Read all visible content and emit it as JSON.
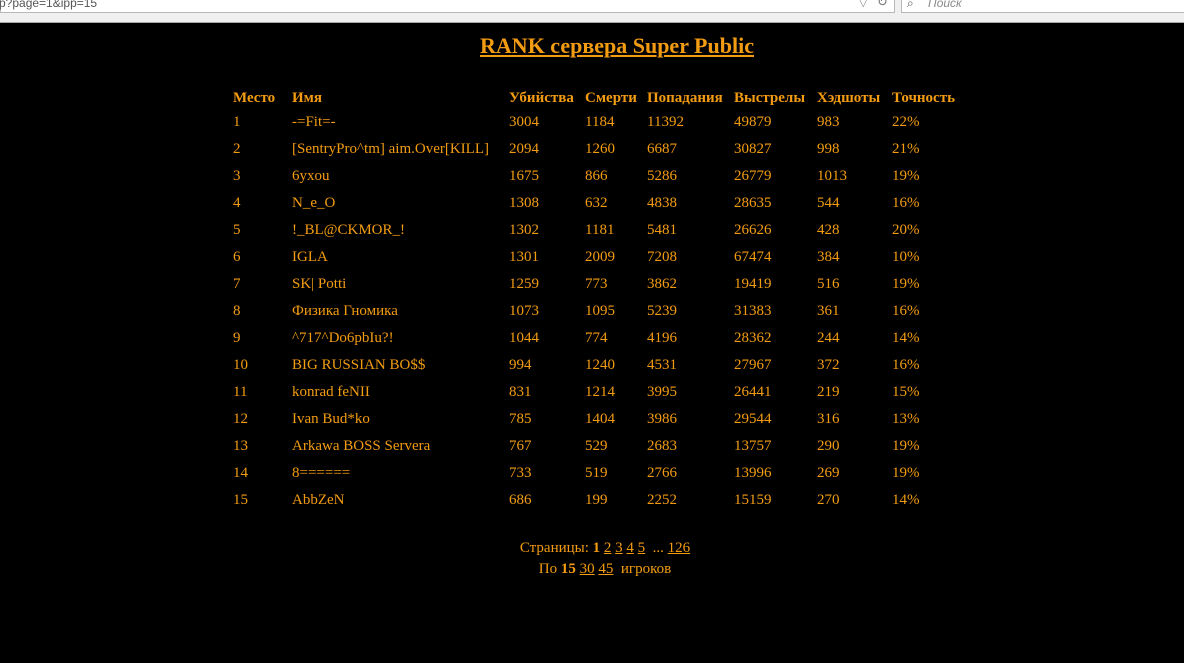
{
  "browser": {
    "url": "p?page=1&ipp=15",
    "search_placeholder": "Поиск"
  },
  "title": "RANK сервера Super Public",
  "table": {
    "headers": [
      "Место",
      "Имя",
      "Убийства",
      "Смерти",
      "Попадания",
      "Выстрелы",
      "Хэдшоты",
      "Точность"
    ],
    "rows": [
      [
        "1",
        "-=Fit=-",
        "3004",
        "1184",
        "11392",
        "49879",
        "983",
        "22%"
      ],
      [
        "2",
        "[SentryPro^tm] aim.Over[KILL]",
        "2094",
        "1260",
        "6687",
        "30827",
        "998",
        "21%"
      ],
      [
        "3",
        "6yxou",
        "1675",
        "866",
        "5286",
        "26779",
        "1013",
        "19%"
      ],
      [
        "4",
        "N_e_O",
        "1308",
        "632",
        "4838",
        "28635",
        "544",
        "16%"
      ],
      [
        "5",
        "!_BL@CKMOR_!",
        "1302",
        "1181",
        "5481",
        "26626",
        "428",
        "20%"
      ],
      [
        "6",
        "IGLA",
        "1301",
        "2009",
        "7208",
        "67474",
        "384",
        "10%"
      ],
      [
        "7",
        "SK| Potti",
        "1259",
        "773",
        "3862",
        "19419",
        "516",
        "19%"
      ],
      [
        "8",
        "Физика Гномика",
        "1073",
        "1095",
        "5239",
        "31383",
        "361",
        "16%"
      ],
      [
        "9",
        "^717^Do6pbIu?!",
        "1044",
        "774",
        "4196",
        "28362",
        "244",
        "14%"
      ],
      [
        "10",
        "BIG RUSSIAN BO$$",
        "994",
        "1240",
        "4531",
        "27967",
        "372",
        "16%"
      ],
      [
        "11",
        "konrad feNII",
        "831",
        "1214",
        "3995",
        "26441",
        "219",
        "15%"
      ],
      [
        "12",
        "Ivan Bud*ko",
        "785",
        "1404",
        "3986",
        "29544",
        "316",
        "13%"
      ],
      [
        "13",
        "Arkawa BOSS Servera",
        "767",
        "529",
        "2683",
        "13757",
        "290",
        "19%"
      ],
      [
        "14",
        "8======",
        "733",
        "519",
        "2766",
        "13996",
        "269",
        "19%"
      ],
      [
        "15",
        "AbbZeN",
        "686",
        "199",
        "2252",
        "15159",
        "270",
        "14%"
      ]
    ]
  },
  "pager": {
    "pages_label": "Страницы:",
    "current_page": "1",
    "page_links": [
      "2",
      "3",
      "4",
      "5"
    ],
    "ellipsis": "...",
    "last_page": "126",
    "per_page_label": "По",
    "per_page_current": "15",
    "per_page_links": [
      "30",
      "45"
    ],
    "per_page_suffix": "игроков"
  },
  "colors": {
    "background": "#000000",
    "text": "#f39c12"
  }
}
